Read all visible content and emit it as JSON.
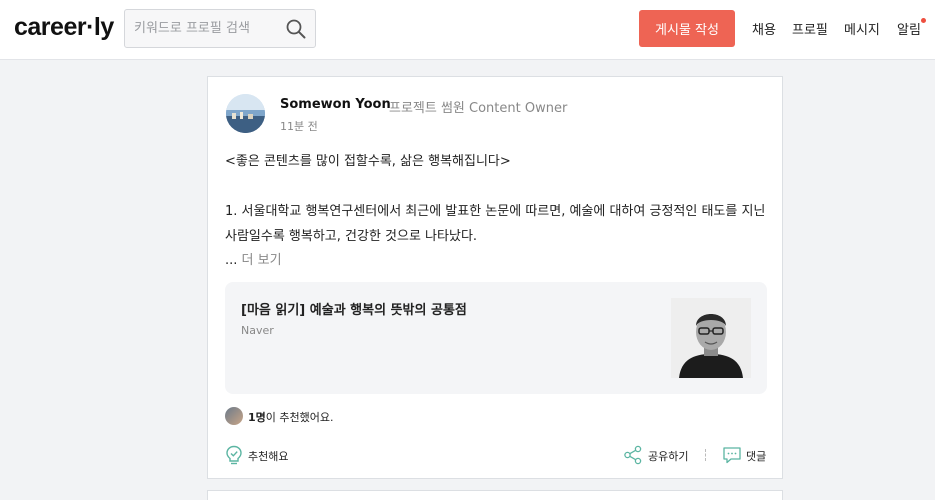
{
  "header": {
    "logo": "career·ly",
    "search_placeholder": "키워드로 프로필 검색",
    "write_button": "게시물 작성",
    "nav": [
      "채용",
      "프로필",
      "메시지",
      "알림"
    ]
  },
  "post": {
    "author_name": "Somewon Yoon",
    "author_title": "프로젝트 썸원 Content Owner",
    "time": "11분 전",
    "lines": [
      "<좋은 콘텐츠를 많이 접할수록, 삶은 행복해집니다>",
      "1. 서울대학교 행복연구센터에서 최근에 발표한 논문에 따르면, 예술에 대하여 긍정적인 태도를 지닌",
      "사람일수록 행복하고, 건강한 것으로 나타났다."
    ],
    "ellipsis": "...",
    "more_label": "더 보기",
    "link_preview": {
      "title": "[마음 읽기] 예술과 행복의 뜻밖의 공통점",
      "source": "Naver"
    },
    "likes": {
      "count": "1명",
      "suffix": "이 추천했어요."
    },
    "actions": {
      "recommend": "추천해요",
      "share": "공유하기",
      "comment": "댓글"
    }
  },
  "colors": {
    "accent": "#ee6454",
    "notification_dot": "#ee4f3f"
  },
  "icons": [
    "search-icon",
    "lightbulb-icon",
    "share-icon",
    "comment-icon"
  ]
}
